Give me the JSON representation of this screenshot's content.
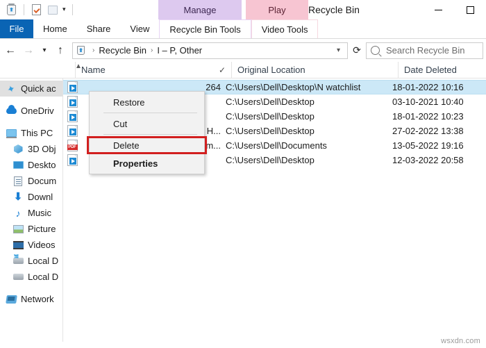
{
  "window": {
    "title": "Recycle Bin",
    "minimize_label": "Minimize",
    "maximize_label": "Maximize"
  },
  "quick_access_toolbar": {
    "items": [
      {
        "name": "recycle-bin-icon",
        "label": "Recycle Bin"
      },
      {
        "name": "properties-icon",
        "label": "Properties"
      },
      {
        "name": "folder-icon",
        "label": "Folder"
      },
      {
        "name": "customize-caret",
        "label": "Customize Quick Access Toolbar"
      }
    ]
  },
  "contextual_headers": [
    {
      "label": "Manage",
      "color": "#ddc9ef"
    },
    {
      "label": "Play",
      "color": "#f7c5d2"
    }
  ],
  "ribbon": {
    "tabs": [
      {
        "label": "File",
        "active": true
      },
      {
        "label": "Home",
        "active": false
      },
      {
        "label": "Share",
        "active": false
      },
      {
        "label": "View",
        "active": false
      },
      {
        "label": "Recycle Bin Tools",
        "active": false
      },
      {
        "label": "Video Tools",
        "active": false
      }
    ]
  },
  "navbar": {
    "back_label": "Back",
    "forward_label": "Forward",
    "recent_label": "Recent locations",
    "up_label": "Up",
    "refresh_label": "Refresh",
    "dropdown_label": "Previous locations",
    "breadcrumb": [
      "Recycle Bin",
      "I – P, Other"
    ],
    "separator": "›"
  },
  "search": {
    "placeholder": "Search Recycle Bin"
  },
  "columns": [
    {
      "label": "Name"
    },
    {
      "label": "Original Location"
    },
    {
      "label": "Date Deleted"
    }
  ],
  "sidebar": {
    "items": [
      {
        "label": "Quick ac",
        "icon": "star-icon",
        "selected": true,
        "indent": false,
        "gap_before": false
      },
      {
        "label": "OneDriv",
        "icon": "cloud-icon",
        "selected": false,
        "indent": false,
        "gap_before": true
      },
      {
        "label": "This PC",
        "icon": "computer-icon",
        "selected": false,
        "indent": false,
        "gap_before": true
      },
      {
        "label": "3D Obj",
        "icon": "3d-objects-icon",
        "selected": false,
        "indent": true,
        "gap_before": false
      },
      {
        "label": "Deskto",
        "icon": "desktop-icon",
        "selected": false,
        "indent": true,
        "gap_before": false
      },
      {
        "label": "Docum",
        "icon": "documents-icon",
        "selected": false,
        "indent": true,
        "gap_before": false
      },
      {
        "label": "Downl",
        "icon": "downloads-icon",
        "selected": false,
        "indent": true,
        "gap_before": false
      },
      {
        "label": "Music",
        "icon": "music-icon",
        "selected": false,
        "indent": true,
        "gap_before": false
      },
      {
        "label": "Picture",
        "icon": "pictures-icon",
        "selected": false,
        "indent": true,
        "gap_before": false
      },
      {
        "label": "Videos",
        "icon": "videos-icon",
        "selected": false,
        "indent": true,
        "gap_before": false
      },
      {
        "label": "Local D",
        "icon": "local-disk-windows-icon",
        "selected": false,
        "indent": true,
        "gap_before": false
      },
      {
        "label": "Local D",
        "icon": "local-disk-icon",
        "selected": false,
        "indent": true,
        "gap_before": false
      },
      {
        "label": "Network",
        "icon": "network-icon",
        "selected": false,
        "indent": false,
        "gap_before": true
      }
    ]
  },
  "files": {
    "rows": [
      {
        "name": "264",
        "location": "C:\\Users\\Dell\\Desktop\\N watchlist",
        "date": "18-01-2022 10:16",
        "icon": "media-file-icon",
        "selected": true
      },
      {
        "name": "",
        "location": "C:\\Users\\Dell\\Desktop",
        "date": "03-10-2021 10:40",
        "icon": "media-file-icon",
        "selected": false
      },
      {
        "name": "",
        "location": "C:\\Users\\Dell\\Desktop",
        "date": "18-01-2022 10:23",
        "icon": "media-file-icon",
        "selected": false
      },
      {
        "name": "l H...",
        "location": "C:\\Users\\Dell\\Desktop",
        "date": "27-02-2022 13:38",
        "icon": "media-file-icon",
        "selected": false
      },
      {
        "name": "orm...",
        "location": "C:\\Users\\Dell\\Documents",
        "date": "13-05-2022 19:16",
        "icon": "pdf-file-icon",
        "selected": false
      },
      {
        "name": "",
        "location": "C:\\Users\\Dell\\Desktop",
        "date": "12-03-2022 20:58",
        "icon": "media-file-icon",
        "selected": false
      }
    ]
  },
  "context_menu": {
    "items": [
      {
        "label": "Restore",
        "bold": false,
        "highlighted": false,
        "separator_after": true
      },
      {
        "label": "Cut",
        "bold": false,
        "highlighted": false,
        "separator_after": true
      },
      {
        "label": "Delete",
        "bold": false,
        "highlighted": true,
        "separator_after": false
      },
      {
        "label": "Properties",
        "bold": true,
        "highlighted": false,
        "separator_after": false
      }
    ],
    "highlight_color": "#d21f1f"
  },
  "watermark": {
    "text": "wsxdn.com"
  }
}
